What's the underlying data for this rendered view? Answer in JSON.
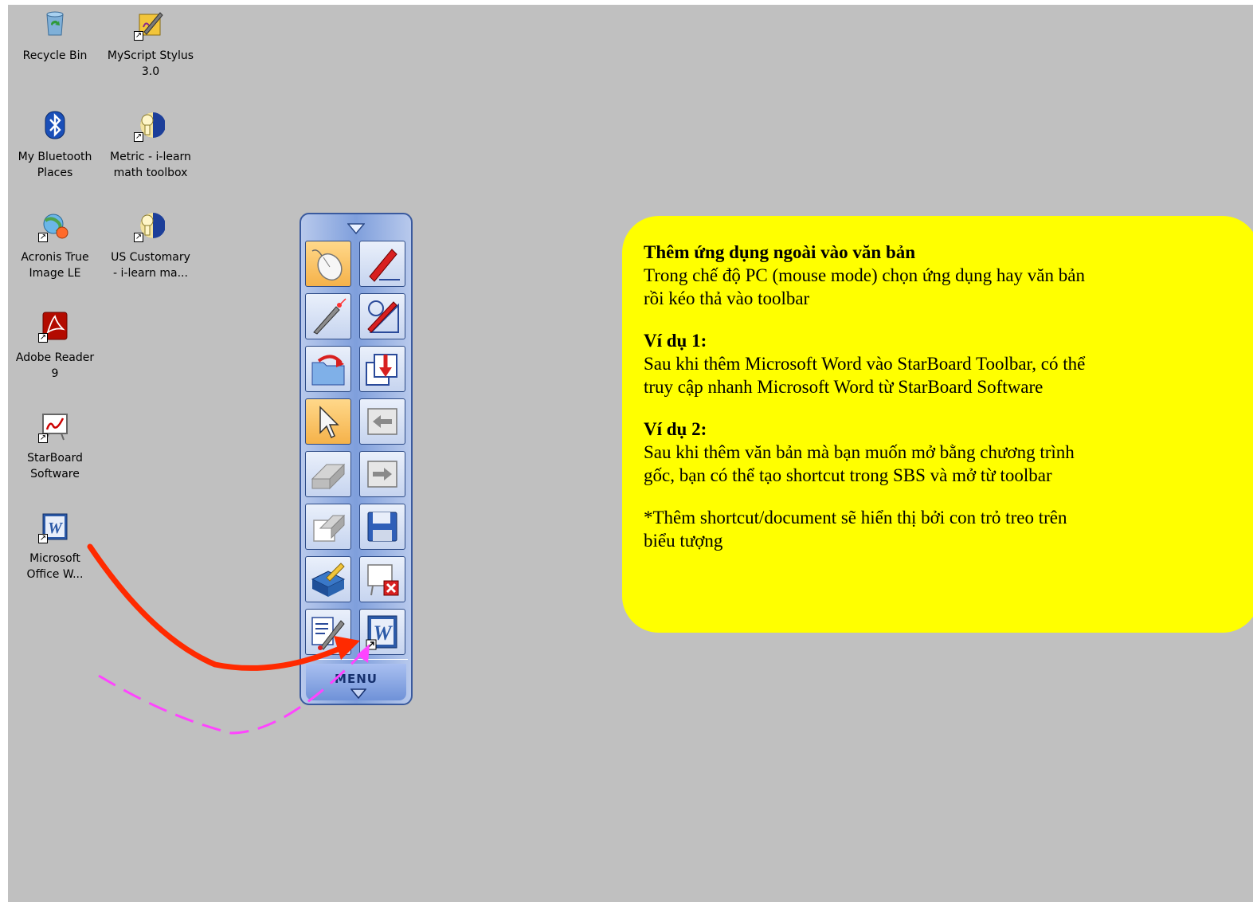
{
  "desktop_icons": [
    {
      "name": "recycle-bin",
      "label": "Recycle Bin",
      "shortcut": false
    },
    {
      "name": "myscript-stylus",
      "label": "MyScript Stylus\n3.0",
      "shortcut": true
    },
    {
      "name": "my-bluetooth-places",
      "label": "My Bluetooth\nPlaces",
      "shortcut": false
    },
    {
      "name": "metric-ilearn",
      "label": "Metric - i-learn\nmath toolbox",
      "shortcut": true
    },
    {
      "name": "acronis-true-image",
      "label": "Acronis True\nImage LE",
      "shortcut": true
    },
    {
      "name": "us-customary-ilearn",
      "label": "US Customary\n- i-learn ma...",
      "shortcut": true
    },
    {
      "name": "adobe-reader",
      "label": "Adobe Reader\n9",
      "shortcut": true
    },
    {
      "name": "starboard-software",
      "label": "StarBoard\nSoftware",
      "shortcut": true
    },
    {
      "name": "microsoft-office-word",
      "label": "Microsoft\nOffice W...",
      "shortcut": true
    }
  ],
  "toolbar": {
    "menu_label": "MENU",
    "buttons": [
      {
        "icon": "mouse-icon",
        "active": true
      },
      {
        "icon": "pen-icon",
        "active": false
      },
      {
        "icon": "laser-pointer-icon",
        "active": false
      },
      {
        "icon": "shapes-icon",
        "active": false
      },
      {
        "icon": "open-file-icon",
        "active": false
      },
      {
        "icon": "import-icon",
        "active": false
      },
      {
        "icon": "select-arrow-icon",
        "active": true
      },
      {
        "icon": "previous-page-icon",
        "active": false
      },
      {
        "icon": "eraser-icon",
        "active": false
      },
      {
        "icon": "next-page-icon",
        "active": false
      },
      {
        "icon": "clear-icon",
        "active": false
      },
      {
        "icon": "save-icon",
        "active": false
      },
      {
        "icon": "tools-icon",
        "active": false
      },
      {
        "icon": "close-board-icon",
        "active": false
      },
      {
        "icon": "edit-toolbar-icon",
        "active": false
      },
      {
        "icon": "word-shortcut-icon",
        "active": false
      }
    ]
  },
  "callout": {
    "title": "Thêm ứng dụng ngoài vào văn bản",
    "intro_line1": "Trong chế độ PC (mouse mode) chọn ứng dụng hay văn bản",
    "intro_line2": "rồi kéo thả vào toolbar",
    "example1_title": "Ví dụ 1:",
    "example1_line1": "Sau khi thêm Microsoft Word vào StarBoard Toolbar, có thể",
    "example1_line2": "truy cập nhanh Microsoft Word từ StarBoard Software",
    "example2_title": "Ví dụ 2:",
    "example2_line1": "Sau khi thêm văn bản mà bạn muốn mở bằng chương trình",
    "example2_line2": "gốc, bạn có thể tạo shortcut trong SBS và mở từ toolbar",
    "note_line1": "*Thêm shortcut/document sẽ hiển thị bởi con trỏ treo trên",
    "note_line2": "biểu tượng"
  },
  "colors": {
    "desktop": "#c0c0c0",
    "callout": "#ffff00",
    "solid_arrow": "#ff2a00",
    "dashed_arrow": "#ff44ff"
  }
}
